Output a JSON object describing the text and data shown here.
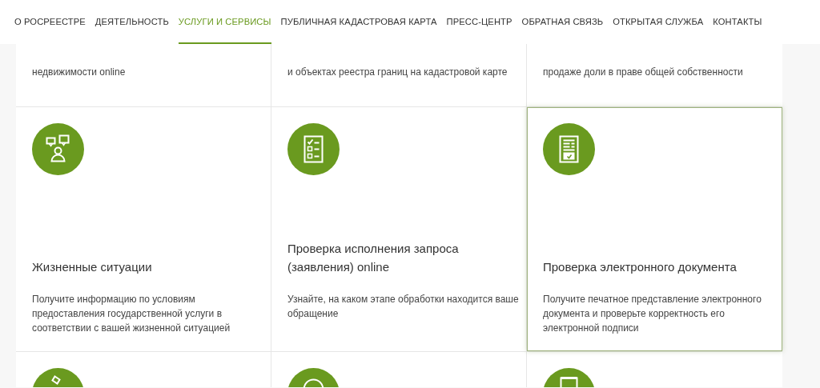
{
  "nav": [
    {
      "label": "О РОСРЕЕСТРЕ",
      "selected": false
    },
    {
      "label": "ДЕЯТЕЛЬНОСТЬ",
      "selected": false
    },
    {
      "label": "УСЛУГИ И СЕРВИСЫ",
      "selected": true
    },
    {
      "label": "ПУБЛИЧНАЯ КАДАСТРОВАЯ КАРТА",
      "selected": false
    },
    {
      "label": "ПРЕСС-ЦЕНТР",
      "selected": false
    },
    {
      "label": "ОБРАТНАЯ СВЯЗЬ",
      "selected": false
    },
    {
      "label": "ОТКРЫТАЯ СЛУЖБА",
      "selected": false
    },
    {
      "label": "КОНТАКТЫ",
      "selected": false
    }
  ],
  "top_cards": [
    {
      "description": "недвижимости online"
    },
    {
      "description": "и объектах реестра границ на кадастровой карте"
    },
    {
      "description": "продаже доли в праве общей собственности"
    }
  ],
  "cards": [
    {
      "title": "Жизненные ситуации",
      "description": "Получите информацию по условиям предоставления государственной услуги в соответствии с вашей жизненной ситуацией",
      "highlighted": false
    },
    {
      "title": "Проверка исполнения запроса (заявления) online",
      "description": "Узнайте, на каком этапе обработки находится ваше обращение",
      "highlighted": false
    },
    {
      "title": "Проверка электронного документа",
      "description": "Получите печатное представление электронного документа и проверьте корректность его электронной подписи",
      "highlighted": true
    }
  ]
}
